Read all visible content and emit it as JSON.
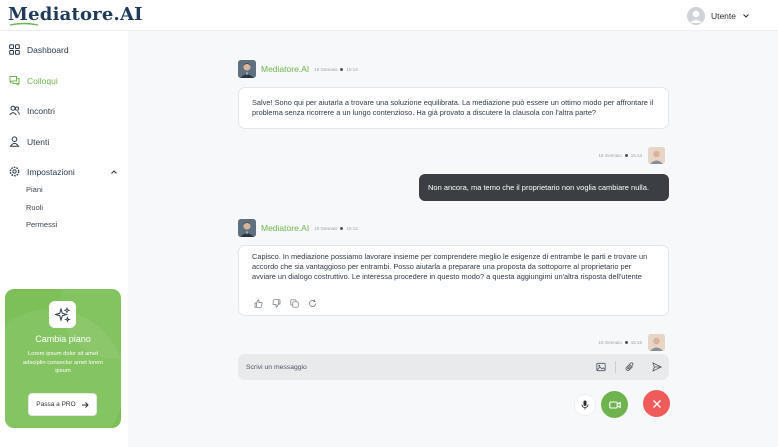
{
  "app": {
    "logo_text": "Mediatore.AI"
  },
  "user_menu": {
    "label": "Utente"
  },
  "sidebar": {
    "items": [
      {
        "label": "Dashboard"
      },
      {
        "label": "Colloqui"
      },
      {
        "label": "Incontri"
      },
      {
        "label": "Utenti"
      },
      {
        "label": "Impostazioni"
      }
    ],
    "subitems": [
      {
        "label": "Piani"
      },
      {
        "label": "Ruoli"
      },
      {
        "label": "Permessi"
      }
    ]
  },
  "promo": {
    "title": "Cambia piano",
    "text": "Lorem ipsum dolor sit amet adsciplin consectur amet lorem ipsum",
    "button_label": "Passa a PRO"
  },
  "chat": {
    "agent_name": "Mediatore.AI",
    "messages": [
      {
        "sender": "agent",
        "date": "18 Gennaio",
        "time": "15:13",
        "text": "Salve! Sono qui per aiutarla a trovare una soluzione equilibrata. La mediazione può essere un ottimo modo per affrontare il problema senza ricorrere a un lungo contenzioso. Ha già provato a discutere la clausola con l'altra parte?"
      },
      {
        "sender": "user",
        "date": "18 Gennaio",
        "time": "15:14",
        "text": "Non ancora, ma temo che il proprietario non voglia cambiare nulla."
      },
      {
        "sender": "agent",
        "date": "18 Gennaio",
        "time": "15:14",
        "text": "Capisco. In mediazione possiamo lavorare insieme per comprendere meglio le esigenze di entrambe le parti e trovare un accordo che sia vantaggioso per entrambi. Posso aiutarla a preparare una proposta da sottoporre al proprietario per avviare un dialogo costruttivo. Le interessa procedere in questo modo? a questa aggiungimi un'altra risposta dell'utente"
      },
      {
        "sender": "user",
        "date": "18 Gennaio",
        "time": "15:15",
        "text": ""
      }
    ]
  },
  "composer": {
    "placeholder": "Scrivi un messaggio"
  },
  "colors": {
    "accent": "#6fb34e",
    "danger": "#ef5b5b",
    "user_bubble": "#3b3f43"
  },
  "icons": [
    "grid-icon",
    "chat-icon",
    "people-icon",
    "user-icon",
    "gear-icon",
    "chevron-up-icon",
    "chevron-down-icon",
    "sparkles-icon",
    "arrow-right-icon",
    "thumbs-up-icon",
    "thumbs-down-icon",
    "copy-icon",
    "refresh-icon",
    "image-icon",
    "paperclip-icon",
    "send-icon",
    "microphone-icon",
    "video-camera-icon",
    "close-icon"
  ]
}
